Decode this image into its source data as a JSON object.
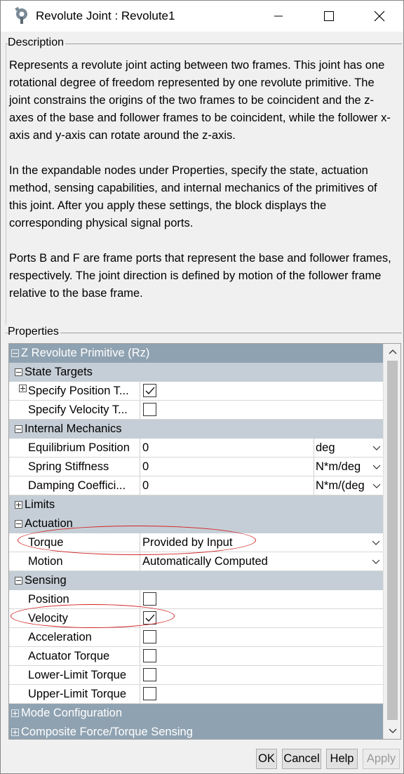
{
  "window": {
    "title": "Revolute Joint : Revolute1",
    "app_icon": "gear-wrench-icon",
    "controls": [
      "minimize-icon",
      "maximize-icon",
      "close-icon"
    ]
  },
  "description": {
    "group_label": "Description",
    "paragraphs": [
      "Represents a revolute joint acting between two frames. This joint has one rotational degree of freedom represented by one revolute primitive. The joint constrains the origins of the two frames to be coincident and the z-axes of the base and follower frames to be coincident, while the follower x-axis and y-axis can rotate around the z-axis.",
      "In the expandable nodes under Properties, specify the state, actuation method, sensing capabilities, and internal mechanics of the primitives of this joint. After you apply these settings, the block displays the corresponding physical signal ports.",
      "Ports B and F are frame ports that represent the base and follower frames, respectively. The joint direction is defined by motion of the follower frame relative to the base frame."
    ]
  },
  "properties": {
    "group_label": "Properties",
    "primitive": "Z Revolute Primitive (Rz)",
    "state_targets": {
      "label": "State Targets",
      "position": {
        "label": "Specify Position T...",
        "checked": true
      },
      "velocity": {
        "label": "Specify Velocity T...",
        "checked": false
      }
    },
    "internal_mechanics": {
      "label": "Internal Mechanics",
      "equilibrium": {
        "label": "Equilibrium Position",
        "value": "0",
        "unit": "deg"
      },
      "stiffness": {
        "label": "Spring Stiffness",
        "value": "0",
        "unit": "N*m/deg"
      },
      "damping": {
        "label": "Damping Coeffici...",
        "value": "0",
        "unit": "N*m/(deg"
      }
    },
    "limits": {
      "label": "Limits"
    },
    "actuation": {
      "label": "Actuation",
      "torque": {
        "label": "Torque",
        "value": "Provided by Input"
      },
      "motion": {
        "label": "Motion",
        "value": "Automatically Computed"
      }
    },
    "sensing": {
      "label": "Sensing",
      "position": {
        "label": "Position",
        "checked": false
      },
      "velocity": {
        "label": "Velocity",
        "checked": true
      },
      "acceleration": {
        "label": "Acceleration",
        "checked": false
      },
      "actuator_torque": {
        "label": "Actuator Torque",
        "checked": false
      },
      "lower_limit_torque": {
        "label": "Lower-Limit Torque",
        "checked": false
      },
      "upper_limit_torque": {
        "label": "Upper-Limit Torque",
        "checked": false
      }
    },
    "mode_configuration": {
      "label": "Mode Configuration"
    },
    "composite_force": {
      "label": "Composite Force/Torque Sensing"
    }
  },
  "buttons": {
    "ok": "OK",
    "cancel": "Cancel",
    "help": "Help",
    "apply": "Apply"
  },
  "colors": {
    "header": "#8fa2b1",
    "subheader": "#c5ced6",
    "annotation": "#d22323"
  }
}
